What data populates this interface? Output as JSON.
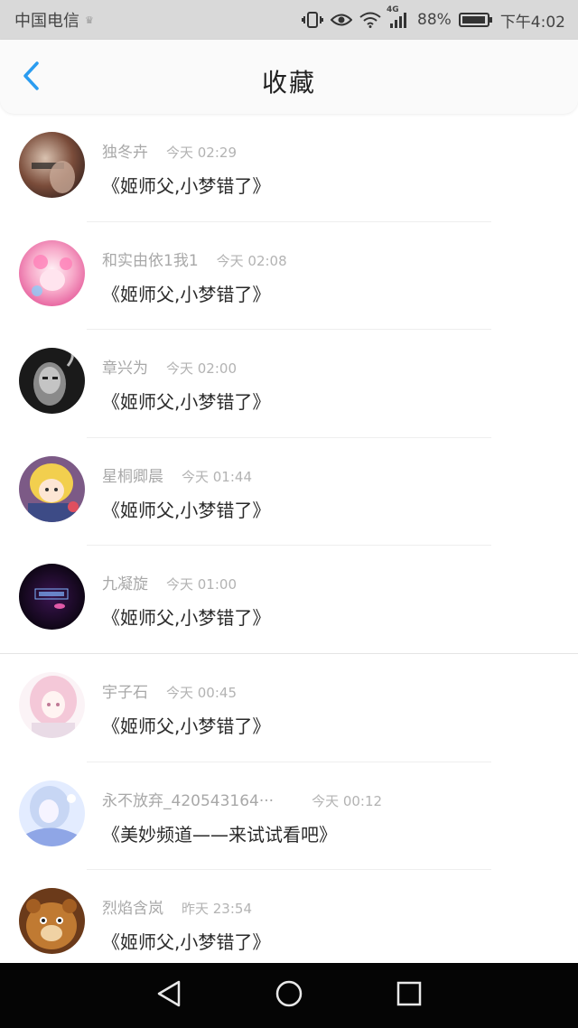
{
  "status_bar": {
    "carrier": "中国电信",
    "carrier_mark": "♛",
    "network": "4G",
    "battery": "88%",
    "time": "下午4:02"
  },
  "header": {
    "title": "收藏",
    "back_icon": "chevron-left-icon",
    "accent_color": "#2a9cf0"
  },
  "favorites": [
    {
      "name": "独冬卉",
      "time": "今天 02:29",
      "title": "《姬师父,小梦错了》",
      "avatar": "avatar-dark-portrait"
    },
    {
      "name": "和实由依1我1",
      "time": "今天 02:08",
      "title": "《姬师父,小梦错了》",
      "avatar": "avatar-pink-anime"
    },
    {
      "name": "章兴为",
      "time": "今天 02:00",
      "title": "《姬师父,小梦错了》",
      "avatar": "avatar-bw-portrait"
    },
    {
      "name": "星桐卿晨",
      "time": "今天 01:44",
      "title": "《姬师父,小梦错了》",
      "avatar": "avatar-blonde-anime"
    },
    {
      "name": "九凝旋",
      "time": "今天 01:00",
      "title": "《姬师父,小梦错了》",
      "avatar": "avatar-dark-logo"
    },
    {
      "name": "宇子石",
      "time": "今天 00:45",
      "title": "《姬师父,小梦错了》",
      "avatar": "avatar-pale-anime"
    },
    {
      "name": "永不放弃_420543164···",
      "time": "今天 00:12",
      "title": "《美妙频道——来试试看吧》",
      "avatar": "avatar-blue-anime"
    },
    {
      "name": "烈焰含岚",
      "time": "昨天 23:54",
      "title": "《姬师父,小梦错了》",
      "avatar": "avatar-cartoon-bear"
    }
  ],
  "nav_bar": {
    "back_icon": "triangle-back-icon",
    "home_icon": "circle-home-icon",
    "recents_icon": "square-recents-icon"
  }
}
